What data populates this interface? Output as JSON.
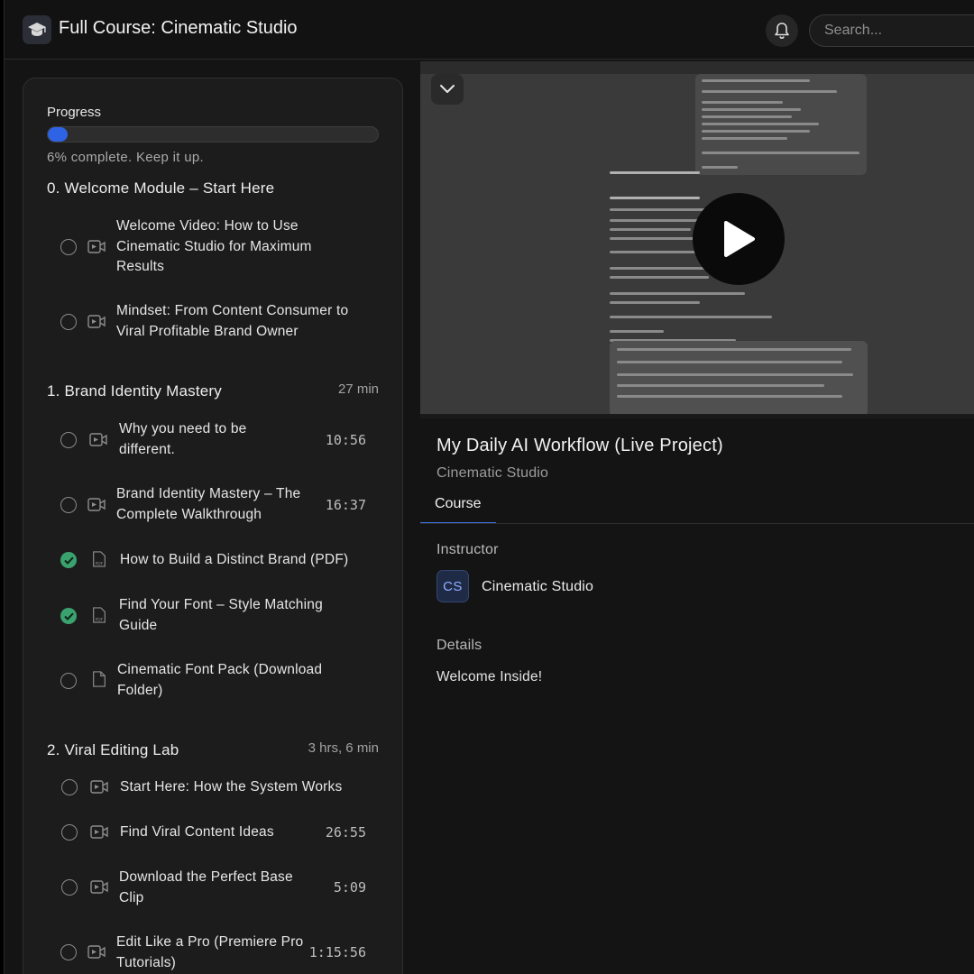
{
  "app": {
    "title": "Full Course: Cinematic Studio"
  },
  "search": {
    "placeholder": "Search..."
  },
  "progress": {
    "label": "Progress",
    "percent": 6,
    "text": "6% complete. Keep it up."
  },
  "modules": [
    {
      "title": "0. Welcome Module – Start Here",
      "duration": "",
      "lessons": [
        {
          "title": "Welcome Video: How to Use Cinematic Studio for Maximum Results",
          "duration": "",
          "type": "video-icon",
          "done": false
        },
        {
          "title": "Mindset: From Content Consumer to Viral Profitable Brand Owner",
          "duration": "",
          "type": "video-icon",
          "done": false
        }
      ]
    },
    {
      "title": "1. Brand Identity Mastery",
      "duration": "27 min",
      "lessons": [
        {
          "title": "Why you need to be different.",
          "duration": "10:56",
          "type": "video-icon",
          "done": false
        },
        {
          "title": "Brand Identity Mastery – The Complete Walkthrough",
          "duration": "16:37",
          "type": "video-icon",
          "done": false
        },
        {
          "title": "How to Build a Distinct Brand (PDF)",
          "duration": "",
          "type": "pdf-icon",
          "done": true
        },
        {
          "title": "Find Your Font – Style Matching Guide",
          "duration": "",
          "type": "pdf-icon",
          "done": true
        },
        {
          "title": "Cinematic Font Pack (Download Folder)",
          "duration": "",
          "type": "file-icon",
          "done": false
        }
      ]
    },
    {
      "title": "2. Viral Editing Lab",
      "duration": "3 hrs, 6 min",
      "lessons": [
        {
          "title": "Start Here: How the System Works",
          "duration": "",
          "type": "video-icon",
          "done": false
        },
        {
          "title": "Find Viral Content Ideas",
          "duration": "26:55",
          "type": "video-icon",
          "done": false
        },
        {
          "title": "Download the Perfect Base Clip",
          "duration": "5:09",
          "type": "video-icon",
          "done": false
        },
        {
          "title": "Edit Like a Pro (Premiere Pro Tutorials)",
          "duration": "1:15:56",
          "type": "video-icon",
          "done": false
        }
      ]
    }
  ],
  "lesson": {
    "title": "My Daily AI Workflow (Live Project)",
    "subtitle": "Cinematic Studio"
  },
  "tabs": [
    {
      "label": "Course",
      "active": true
    }
  ],
  "instructor": {
    "heading": "Instructor",
    "initials": "CS",
    "name": "Cinematic Studio"
  },
  "details": {
    "heading": "Details",
    "text": "Welcome Inside!"
  },
  "colors": {
    "accent": "#2f63e6",
    "done": "#3aa26e",
    "background": "#141414",
    "panel": "#1c1c1c"
  }
}
